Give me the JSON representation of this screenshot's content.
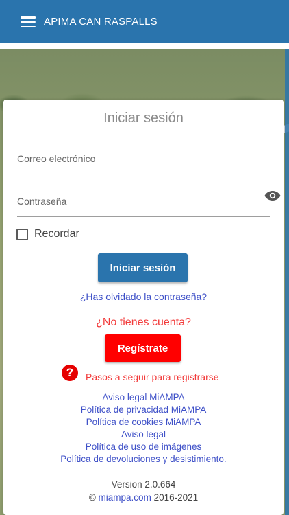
{
  "app": {
    "title": "APIMA CAN RASPALLS"
  },
  "login": {
    "title": "Iniciar sesión",
    "email_placeholder": "Correo electrónico",
    "password_placeholder": "Contraseña",
    "remember_label": "Recordar",
    "login_button": "Iniciar sesión",
    "forgot_password": "¿Has olvidado la contraseña?"
  },
  "register": {
    "prompt": "¿No tienes cuenta?",
    "button": "Regístrate",
    "steps_label": "Pasos a seguir para registrarse",
    "help_glyph": "?"
  },
  "links": [
    "Aviso legal MiAMPA",
    "Política de privacidad MiAMPA",
    "Política de cookies MiAMPA",
    "Aviso legal",
    "Política de uso de imágenes",
    "Política de devoluciones y desistimiento."
  ],
  "footer": {
    "version": "Version 2.0.664",
    "copyright_symbol": "©",
    "site": "miampa.com",
    "years": "2016-2021"
  },
  "icons": {
    "menu": "menu-icon",
    "eye": "eye-icon",
    "help": "help-circle-icon"
  },
  "colors": {
    "primary": "#2a74ad",
    "danger": "#ff0000",
    "link": "#3f51c8",
    "danger_text": "#f23a3a"
  }
}
